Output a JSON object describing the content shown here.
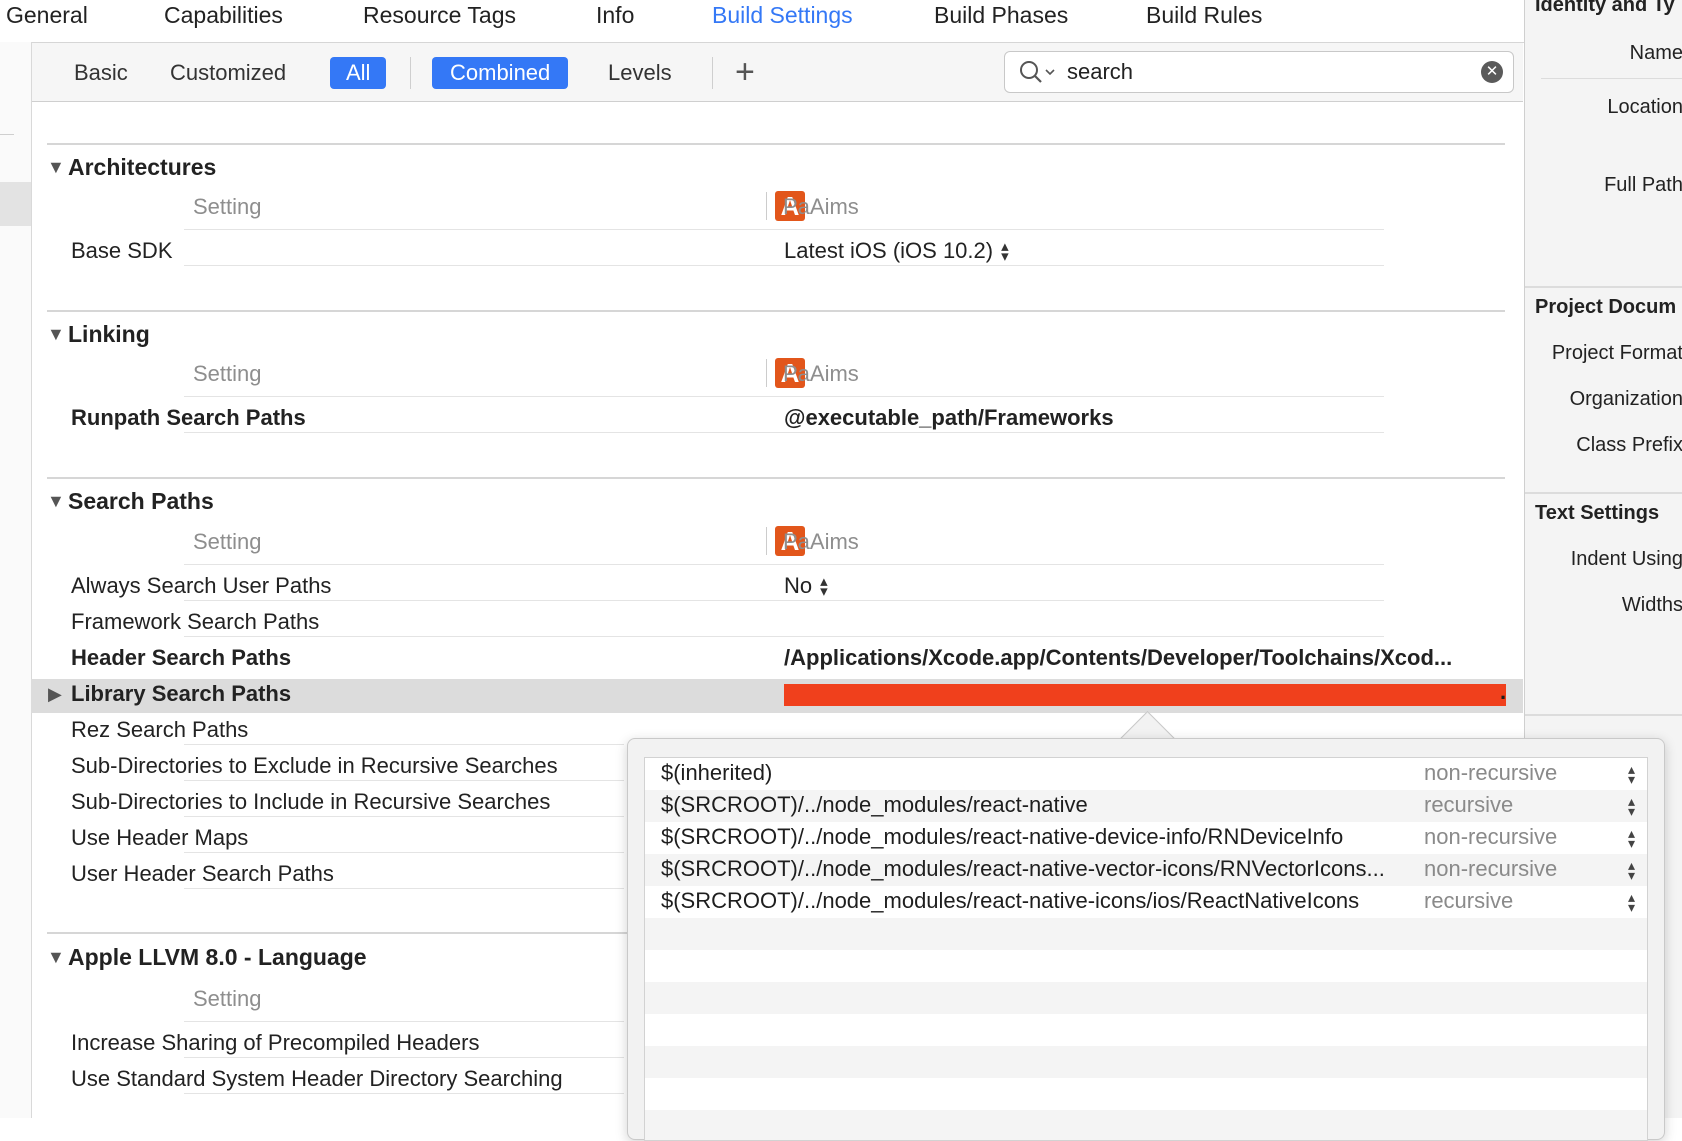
{
  "tabs": {
    "general": "General",
    "capabilities": "Capabilities",
    "resource_tags": "Resource Tags",
    "info": "Info",
    "build_settings": "Build Settings",
    "build_phases": "Build Phases",
    "build_rules": "Build Rules",
    "active": "Build Settings"
  },
  "filter": {
    "basic": "Basic",
    "customized": "Customized",
    "all": "All",
    "combined": "Combined",
    "levels": "Levels",
    "add": "+",
    "search_value": "search"
  },
  "columns": {
    "setting": "Setting",
    "target": "PaAims",
    "target_icon_letter": "A"
  },
  "sections": {
    "architectures": {
      "title": "Architectures",
      "rows": [
        {
          "name": "Base SDK",
          "value": "Latest iOS (iOS 10.2)"
        }
      ]
    },
    "linking": {
      "title": "Linking",
      "rows": [
        {
          "name": "Runpath Search Paths",
          "value": "@executable_path/Frameworks"
        }
      ]
    },
    "search_paths": {
      "title": "Search Paths",
      "rows": [
        {
          "name": "Always Search User Paths",
          "value": "No"
        },
        {
          "name": "Framework Search Paths",
          "value": ""
        },
        {
          "name": "Header Search Paths",
          "value": "/Applications/Xcode.app/Contents/Developer/Toolchains/Xcod..."
        },
        {
          "name": "Library Search Paths",
          "value": ""
        },
        {
          "name": "Rez Search Paths",
          "value": ""
        },
        {
          "name": "Sub-Directories to Exclude in Recursive Searches",
          "value": ""
        },
        {
          "name": "Sub-Directories to Include in Recursive Searches",
          "value": ""
        },
        {
          "name": "Use Header Maps",
          "value": ""
        },
        {
          "name": "User Header Search Paths",
          "value": ""
        }
      ]
    },
    "llvm_language": {
      "title": "Apple LLVM 8.0 - Language",
      "rows": [
        {
          "name": "Increase Sharing of Precompiled Headers",
          "value": ""
        },
        {
          "name": "Use Standard System Header Directory Searching",
          "value": ""
        }
      ]
    }
  },
  "library_search_paths_popover": [
    {
      "path": "$(inherited)",
      "mode": "non-recursive"
    },
    {
      "path": "$(SRCROOT)/../node_modules/react-native",
      "mode": "recursive"
    },
    {
      "path": "$(SRCROOT)/../node_modules/react-native-device-info/RNDeviceInfo",
      "mode": "non-recursive"
    },
    {
      "path": "$(SRCROOT)/../node_modules/react-native-vector-icons/RNVectorIcons...",
      "mode": "non-recursive"
    },
    {
      "path": "$(SRCROOT)/../node_modules/react-native-icons/ios/ReactNativeIcons",
      "mode": "recursive"
    }
  ],
  "inspector": {
    "identity_header": "Identity and Ty",
    "name_label": "Name",
    "location_label": "Location",
    "full_path_label": "Full Path",
    "project_document_header": "Project Docum",
    "project_format_label": "Project Format",
    "organization_label": "Organization",
    "class_prefix_label": "Class Prefix",
    "text_settings_header": "Text Settings",
    "indent_using_label": "Indent Using",
    "widths_label": "Widths"
  },
  "colors": {
    "accent": "#3478f6",
    "target_icon": "#e2561b",
    "redaction": "#f0401c"
  }
}
